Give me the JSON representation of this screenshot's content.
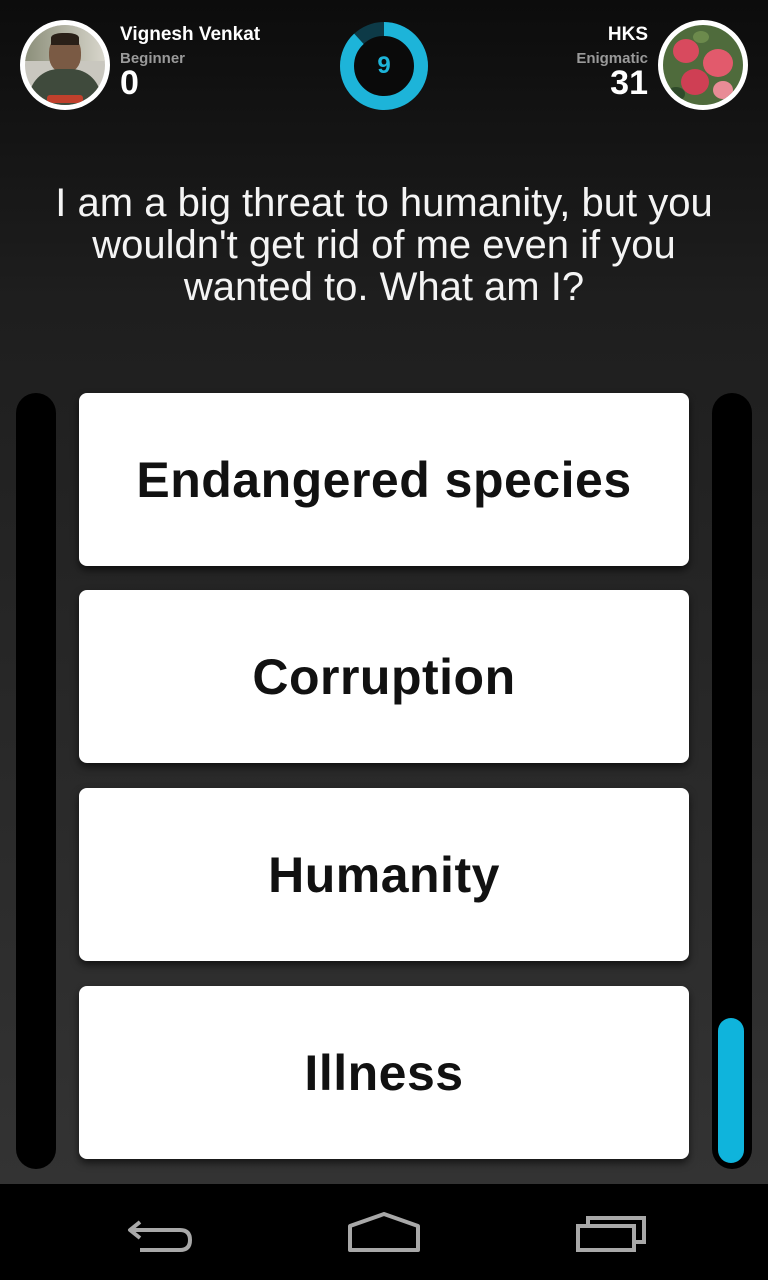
{
  "player_left": {
    "name": "Vignesh Venkat",
    "rank": "Beginner",
    "score": "0"
  },
  "player_right": {
    "name": "HKS",
    "rank": "Enigmatic",
    "score": "31"
  },
  "timer": {
    "value": "9",
    "remaining_fraction": 0.88,
    "color": "#1db4d9"
  },
  "question": {
    "text": "I am a big threat to humanity, but you wouldn't get rid of me even if you wanted to. What am I?"
  },
  "answers": [
    {
      "label": "Endangered species"
    },
    {
      "label": "Corruption"
    },
    {
      "label": "Humanity"
    },
    {
      "label": "Illness"
    }
  ],
  "progress": {
    "right_fill_fraction": 0.19,
    "color": "#0fb4dc"
  },
  "navbar": {
    "icons": [
      "back-icon",
      "home-icon",
      "recent-apps-icon"
    ]
  }
}
